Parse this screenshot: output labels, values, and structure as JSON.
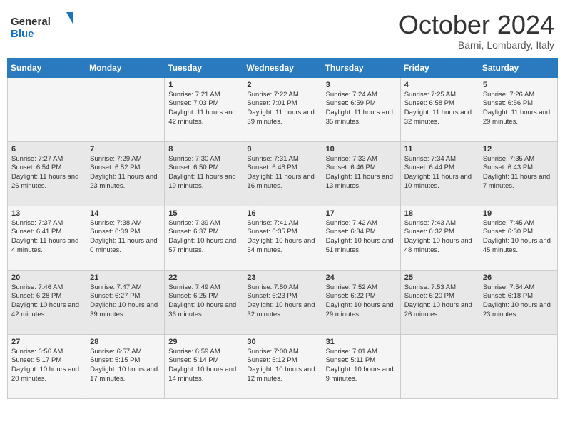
{
  "logo": {
    "text_general": "General",
    "text_blue": "Blue"
  },
  "header": {
    "month_year": "October 2024",
    "location": "Barni, Lombardy, Italy"
  },
  "weekdays": [
    "Sunday",
    "Monday",
    "Tuesday",
    "Wednesday",
    "Thursday",
    "Friday",
    "Saturday"
  ],
  "rows": [
    [
      null,
      null,
      {
        "day": "1",
        "sunrise": "Sunrise: 7:21 AM",
        "sunset": "Sunset: 7:03 PM",
        "daylight": "Daylight: 11 hours and 42 minutes."
      },
      {
        "day": "2",
        "sunrise": "Sunrise: 7:22 AM",
        "sunset": "Sunset: 7:01 PM",
        "daylight": "Daylight: 11 hours and 39 minutes."
      },
      {
        "day": "3",
        "sunrise": "Sunrise: 7:24 AM",
        "sunset": "Sunset: 6:59 PM",
        "daylight": "Daylight: 11 hours and 35 minutes."
      },
      {
        "day": "4",
        "sunrise": "Sunrise: 7:25 AM",
        "sunset": "Sunset: 6:58 PM",
        "daylight": "Daylight: 11 hours and 32 minutes."
      },
      {
        "day": "5",
        "sunrise": "Sunrise: 7:26 AM",
        "sunset": "Sunset: 6:56 PM",
        "daylight": "Daylight: 11 hours and 29 minutes."
      }
    ],
    [
      {
        "day": "6",
        "sunrise": "Sunrise: 7:27 AM",
        "sunset": "Sunset: 6:54 PM",
        "daylight": "Daylight: 11 hours and 26 minutes."
      },
      {
        "day": "7",
        "sunrise": "Sunrise: 7:29 AM",
        "sunset": "Sunset: 6:52 PM",
        "daylight": "Daylight: 11 hours and 23 minutes."
      },
      {
        "day": "8",
        "sunrise": "Sunrise: 7:30 AM",
        "sunset": "Sunset: 6:50 PM",
        "daylight": "Daylight: 11 hours and 19 minutes."
      },
      {
        "day": "9",
        "sunrise": "Sunrise: 7:31 AM",
        "sunset": "Sunset: 6:48 PM",
        "daylight": "Daylight: 11 hours and 16 minutes."
      },
      {
        "day": "10",
        "sunrise": "Sunrise: 7:33 AM",
        "sunset": "Sunset: 6:46 PM",
        "daylight": "Daylight: 11 hours and 13 minutes."
      },
      {
        "day": "11",
        "sunrise": "Sunrise: 7:34 AM",
        "sunset": "Sunset: 6:44 PM",
        "daylight": "Daylight: 11 hours and 10 minutes."
      },
      {
        "day": "12",
        "sunrise": "Sunrise: 7:35 AM",
        "sunset": "Sunset: 6:43 PM",
        "daylight": "Daylight: 11 hours and 7 minutes."
      }
    ],
    [
      {
        "day": "13",
        "sunrise": "Sunrise: 7:37 AM",
        "sunset": "Sunset: 6:41 PM",
        "daylight": "Daylight: 11 hours and 4 minutes."
      },
      {
        "day": "14",
        "sunrise": "Sunrise: 7:38 AM",
        "sunset": "Sunset: 6:39 PM",
        "daylight": "Daylight: 11 hours and 0 minutes."
      },
      {
        "day": "15",
        "sunrise": "Sunrise: 7:39 AM",
        "sunset": "Sunset: 6:37 PM",
        "daylight": "Daylight: 10 hours and 57 minutes."
      },
      {
        "day": "16",
        "sunrise": "Sunrise: 7:41 AM",
        "sunset": "Sunset: 6:35 PM",
        "daylight": "Daylight: 10 hours and 54 minutes."
      },
      {
        "day": "17",
        "sunrise": "Sunrise: 7:42 AM",
        "sunset": "Sunset: 6:34 PM",
        "daylight": "Daylight: 10 hours and 51 minutes."
      },
      {
        "day": "18",
        "sunrise": "Sunrise: 7:43 AM",
        "sunset": "Sunset: 6:32 PM",
        "daylight": "Daylight: 10 hours and 48 minutes."
      },
      {
        "day": "19",
        "sunrise": "Sunrise: 7:45 AM",
        "sunset": "Sunset: 6:30 PM",
        "daylight": "Daylight: 10 hours and 45 minutes."
      }
    ],
    [
      {
        "day": "20",
        "sunrise": "Sunrise: 7:46 AM",
        "sunset": "Sunset: 6:28 PM",
        "daylight": "Daylight: 10 hours and 42 minutes."
      },
      {
        "day": "21",
        "sunrise": "Sunrise: 7:47 AM",
        "sunset": "Sunset: 6:27 PM",
        "daylight": "Daylight: 10 hours and 39 minutes."
      },
      {
        "day": "22",
        "sunrise": "Sunrise: 7:49 AM",
        "sunset": "Sunset: 6:25 PM",
        "daylight": "Daylight: 10 hours and 36 minutes."
      },
      {
        "day": "23",
        "sunrise": "Sunrise: 7:50 AM",
        "sunset": "Sunset: 6:23 PM",
        "daylight": "Daylight: 10 hours and 32 minutes."
      },
      {
        "day": "24",
        "sunrise": "Sunrise: 7:52 AM",
        "sunset": "Sunset: 6:22 PM",
        "daylight": "Daylight: 10 hours and 29 minutes."
      },
      {
        "day": "25",
        "sunrise": "Sunrise: 7:53 AM",
        "sunset": "Sunset: 6:20 PM",
        "daylight": "Daylight: 10 hours and 26 minutes."
      },
      {
        "day": "26",
        "sunrise": "Sunrise: 7:54 AM",
        "sunset": "Sunset: 6:18 PM",
        "daylight": "Daylight: 10 hours and 23 minutes."
      }
    ],
    [
      {
        "day": "27",
        "sunrise": "Sunrise: 6:56 AM",
        "sunset": "Sunset: 5:17 PM",
        "daylight": "Daylight: 10 hours and 20 minutes."
      },
      {
        "day": "28",
        "sunrise": "Sunrise: 6:57 AM",
        "sunset": "Sunset: 5:15 PM",
        "daylight": "Daylight: 10 hours and 17 minutes."
      },
      {
        "day": "29",
        "sunrise": "Sunrise: 6:59 AM",
        "sunset": "Sunset: 5:14 PM",
        "daylight": "Daylight: 10 hours and 14 minutes."
      },
      {
        "day": "30",
        "sunrise": "Sunrise: 7:00 AM",
        "sunset": "Sunset: 5:12 PM",
        "daylight": "Daylight: 10 hours and 12 minutes."
      },
      {
        "day": "31",
        "sunrise": "Sunrise: 7:01 AM",
        "sunset": "Sunset: 5:11 PM",
        "daylight": "Daylight: 10 hours and 9 minutes."
      },
      null,
      null
    ]
  ]
}
